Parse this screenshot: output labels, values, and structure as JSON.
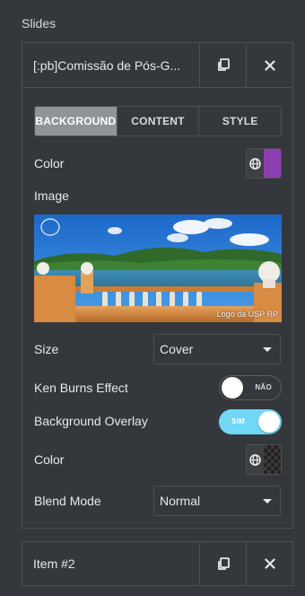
{
  "section": {
    "title": "Slides"
  },
  "slides": [
    {
      "title": "[:pb]Comissão de Pós-G...",
      "tabs": [
        {
          "label": "BACKGROUND",
          "active": true
        },
        {
          "label": "CONTENT",
          "active": false
        },
        {
          "label": "STYLE",
          "active": false
        }
      ],
      "background": {
        "color_label": "Color",
        "color_value": "#8b3fb0",
        "image_label": "Image",
        "image_watermark": "Logo da USP RP",
        "size_label": "Size",
        "size_value": "Cover",
        "ken_burns_label": "Ken Burns Effect",
        "ken_burns_state": "NÃO",
        "ken_burns_on": false,
        "overlay_label": "Background Overlay",
        "overlay_state": "SIM",
        "overlay_on": true,
        "overlay_color_label": "Color",
        "blend_mode_label": "Blend Mode",
        "blend_mode_value": "Normal"
      }
    },
    {
      "title": "Item #2"
    }
  ],
  "icons": {
    "duplicate": "copy-icon",
    "remove": "close-icon",
    "global": "globe-icon",
    "dropdown": "chevron-down-icon"
  },
  "colors": {
    "panel_bg": "#34383c",
    "border": "#4c5156",
    "tab_active": "#8f9499",
    "switch_on": "#71d7f7",
    "purple_swatch": "#8b3fb0"
  }
}
